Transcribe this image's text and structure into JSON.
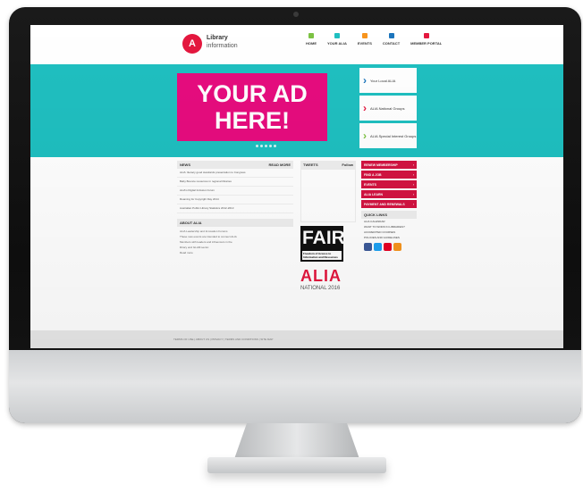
{
  "site": {
    "logo_mark": "A",
    "logo_line1": "Library",
    "logo_line2": "information"
  },
  "nav": [
    {
      "label": "HOME",
      "color": "#7cc243"
    },
    {
      "label": "YOUR ALIA",
      "color": "#1fbfc0"
    },
    {
      "label": "EVENTS",
      "color": "#f7941d"
    },
    {
      "label": "CONTACT",
      "color": "#1c75bc"
    },
    {
      "label": "MEMBER PORTAL",
      "color": "#e4173e"
    }
  ],
  "hero": {
    "ad_text": "YOUR AD HERE!",
    "tiles": [
      {
        "label": "Your Local ALIA",
        "arrow_color": "#1c75bc"
      },
      {
        "label": "ALIA National Groups",
        "arrow_color": "#e4173e"
      },
      {
        "label": "ALIA Special Interest Groups",
        "arrow_color": "#7cc243"
      }
    ]
  },
  "news": {
    "header": "NEWS",
    "more": "READ MORE",
    "items": [
      "ALIA: literacy good standards presentation to Congress",
      "Baby Bounce resources in regional libraries",
      "ALIA's Digital Inclusion forum",
      "Roaming for Copyright Day 2014",
      "Australian Public Library Statistics 2012-2013"
    ]
  },
  "about": {
    "header": "ABOUT ALIA",
    "lines": [
      "ALIA Leadership and Innovation Forums",
      "These new events are intended to connect ALIA",
      "Members with leaders and influencers in the",
      "library and GLAM sector.",
      "",
      "Read more"
    ]
  },
  "tweets": {
    "header": "TWEETS",
    "follow": "Follow"
  },
  "fair": {
    "title": "FAIR",
    "sub": "Freedom of Access to Information and Resources"
  },
  "alia_logo": "ALIA",
  "national": "NATIONAL 2016",
  "actions": [
    "RENEW MEMBERSHIP",
    "FIND A JOB",
    "EVENTS",
    "ALIA LEARN",
    "PAYMENT AND RENEWALS"
  ],
  "quick": {
    "header": "QUICK LINKS",
    "links": [
      "ALIA CALENDAR",
      "WANT TO WORK IN LIBRARIES?",
      "ACCREDITED COURSES",
      "POLICIES AND GUIDELINES"
    ],
    "social": [
      {
        "name": "facebook-icon",
        "color": "#3b5998"
      },
      {
        "name": "twitter-icon",
        "color": "#1da1f2"
      },
      {
        "name": "pinterest-icon",
        "color": "#e60023"
      },
      {
        "name": "rss-icon",
        "color": "#f7941d"
      }
    ]
  },
  "footer": "TERMS OF USE  |  ABOUT US  |  PRIVACY  |  TERMS AND CONDITIONS  |  SITE MAP"
}
